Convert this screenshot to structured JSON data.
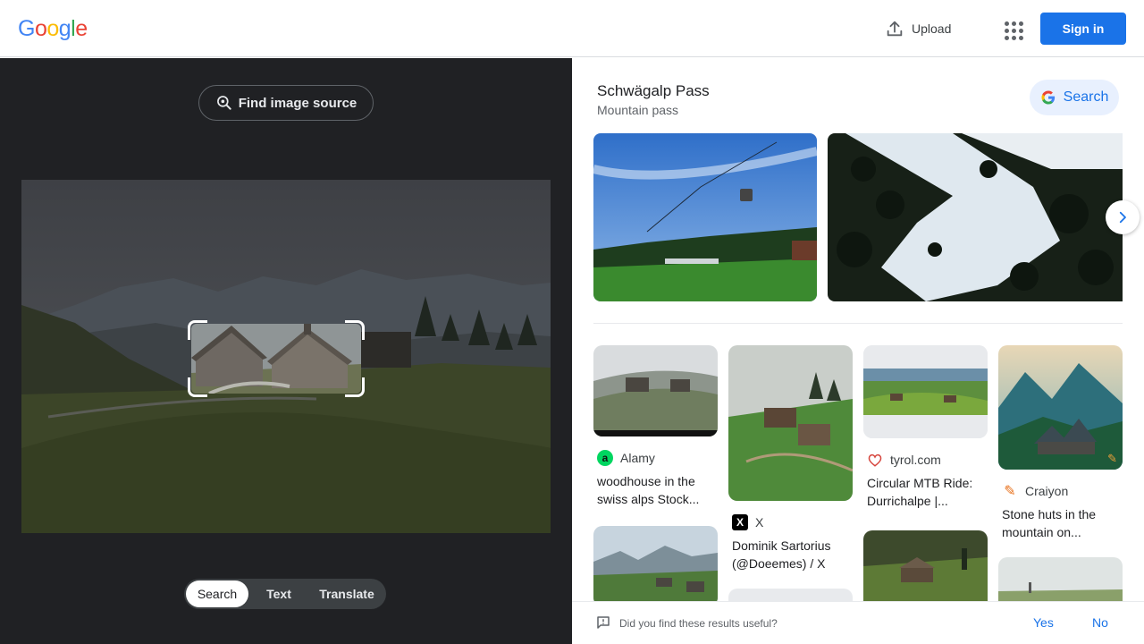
{
  "header": {
    "logo_letters": [
      "G",
      "o",
      "o",
      "g",
      "l",
      "e"
    ],
    "logo_colors": [
      "#4285f4",
      "#ea4335",
      "#fbbc05",
      "#4285f4",
      "#34a853",
      "#ea4335"
    ],
    "upload_label": "Upload",
    "upload_icon": "upload-icon",
    "apps_icon": "apps-grid-icon",
    "signin_label": "Sign in"
  },
  "lens": {
    "find_source_label": "Find image source",
    "modes": [
      {
        "label": "Search",
        "active": true
      },
      {
        "label": "Text",
        "active": false
      },
      {
        "label": "Translate",
        "active": false
      }
    ]
  },
  "knowledge_panel": {
    "title": "Schwägalp Pass",
    "subtitle": "Mountain pass",
    "search_label": "Search",
    "next_icon": "chevron-right-icon"
  },
  "results": [
    {
      "source": "Alamy",
      "source_icon": "alamy-icon",
      "title_line1": "woodhouse in the",
      "title_line2": "swiss alps Stock..."
    },
    {
      "source": "X",
      "source_icon": "x-icon",
      "title_line1": "Dominik Sartorius",
      "title_line2": "(@Doeemes) / X"
    },
    {
      "source": "tyrol.com",
      "source_icon": "tyrol-icon",
      "title_line1": "Circular MTB Ride:",
      "title_line2": "Durrichalpe |..."
    },
    {
      "source": "Craiyon",
      "source_icon": "craiyon-pencil-icon",
      "title_line1": "Stone huts in the",
      "title_line2": "mountain on..."
    }
  ],
  "feedback": {
    "question": "Did you find these results useful?",
    "yes_label": "Yes",
    "no_label": "No"
  },
  "colors": {
    "accent": "#1a73e8",
    "dark_panel": "#202124"
  }
}
